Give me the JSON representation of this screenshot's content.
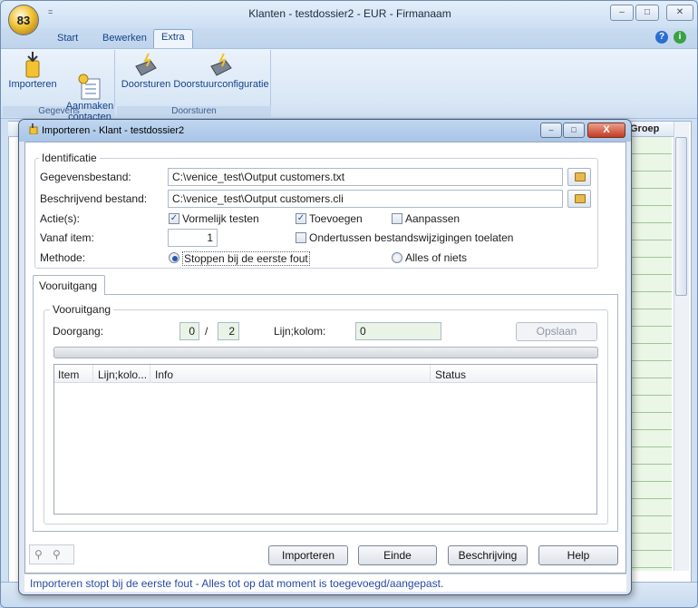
{
  "window": {
    "title": "Klanten - testdossier2 - EUR - Firmanaam",
    "app_button_label": "83",
    "quick_access_arrow": "=",
    "minimize_glyph": "–",
    "maximize_glyph": "□",
    "close_glyph": "✕"
  },
  "ribbon": {
    "tabs": [
      {
        "label": "Start"
      },
      {
        "label": "Bewerken"
      },
      {
        "label": "Extra"
      }
    ],
    "active_tab": "Extra",
    "groups": [
      {
        "label": "Gegevens",
        "buttons": [
          {
            "label": "Importeren",
            "icon": "import-icon"
          },
          {
            "label": "Aanmaken\ncontacten",
            "icon": "create-contacts-icon"
          }
        ]
      },
      {
        "label": "Doorsturen",
        "buttons": [
          {
            "label": "Doorsturen",
            "icon": "forward-icon"
          },
          {
            "label": "Doorstuurconfiguratie",
            "icon": "forward-config-icon"
          }
        ]
      }
    ],
    "help_glyph": "?",
    "info_glyph": "i"
  },
  "grid": {
    "visible_column": "Groep"
  },
  "dialog": {
    "title": "Importeren - Klant - testdossier2",
    "close_glyph": "X",
    "identificatie": {
      "legend": "Identificatie",
      "gegevensbestand_label": "Gegevensbestand:",
      "gegevensbestand_value": "C:\\venice_test\\Output customers.txt",
      "beschrijvend_label": "Beschrijvend bestand:",
      "beschrijvend_value": "C:\\venice_test\\Output customers.cli",
      "acties_label": "Actie(s):",
      "acties": [
        {
          "label": "Vormelijk testen",
          "checked": true
        },
        {
          "label": "Toevoegen",
          "checked": true
        },
        {
          "label": "Aanpassen",
          "checked": false
        }
      ],
      "vanaf_label": "Vanaf item:",
      "vanaf_value": "1",
      "ondertussen_label": "Ondertussen bestandswijzigingen toelaten",
      "ondertussen_checked": false,
      "methode_label": "Methode:",
      "methodes": [
        {
          "label": "Stoppen bij de eerste fout",
          "selected": true
        },
        {
          "label": "Alles of niets",
          "selected": false
        }
      ]
    },
    "tab_label": "Vooruitgang",
    "vooruitgang": {
      "legend": "Vooruitgang",
      "doorgang_label": "Doorgang:",
      "doorgang_value": "0",
      "separator": "/",
      "doorgang_total": "2",
      "lijn_label": "Lijn;kolom:",
      "lijn_value": "0",
      "opslaan_label": "Opslaan",
      "progress": 0
    },
    "list": {
      "columns": [
        "Item",
        "Lijn;kolo...",
        "Info",
        "Status"
      ],
      "rows": []
    },
    "buttons": {
      "importeren": "Importeren",
      "einde": "Einde",
      "beschrijving": "Beschrijving",
      "help": "Help"
    },
    "status_text": "Importeren stopt bij de eerste fout - Alles tot op dat moment is toegevoegd/aangepast."
  }
}
